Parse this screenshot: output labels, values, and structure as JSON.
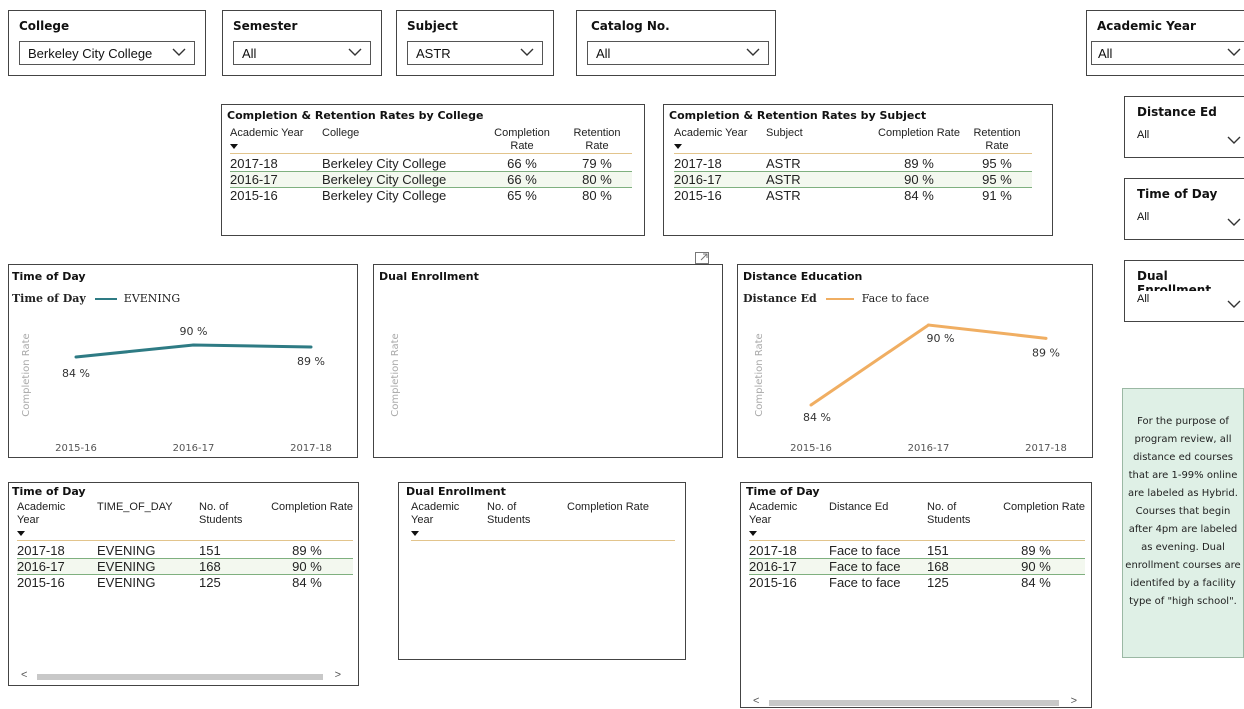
{
  "filters": {
    "college": {
      "label": "College",
      "value": "Berkeley City College"
    },
    "semester": {
      "label": "Semester",
      "value": "All"
    },
    "subject": {
      "label": "Subject",
      "value": "ASTR"
    },
    "catalog": {
      "label": "Catalog No.",
      "value": "All"
    },
    "academic_year": {
      "label": "Academic Year",
      "value": "All"
    },
    "distance_ed": {
      "label": "Distance Ed",
      "value": "All"
    },
    "time_of_day": {
      "label": "Time of Day",
      "value": "All"
    },
    "dual_enrollment": {
      "label": "Dual Enrollment",
      "value": "All"
    }
  },
  "table_college": {
    "title": "Completion & Retention Rates by College",
    "headers": [
      "Academic Year",
      "College",
      "Completion Rate",
      "Retention Rate"
    ],
    "rows": [
      [
        "2017-18",
        "Berkeley City College",
        "66 %",
        "79 %"
      ],
      [
        "2016-17",
        "Berkeley City College",
        "66 %",
        "80 %"
      ],
      [
        "2015-16",
        "Berkeley City College",
        "65 %",
        "80 %"
      ]
    ]
  },
  "table_subject": {
    "title": "Completion & Retention Rates by Subject",
    "headers": [
      "Academic Year",
      "Subject",
      "Completion Rate",
      "Retention Rate"
    ],
    "rows": [
      [
        "2017-18",
        "ASTR",
        "89 %",
        "95 %"
      ],
      [
        "2016-17",
        "ASTR",
        "90 %",
        "95 %"
      ],
      [
        "2015-16",
        "ASTR",
        "84 %",
        "91 %"
      ]
    ]
  },
  "chart_data": [
    {
      "type": "line",
      "title": "Time of Day",
      "legend_title": "Time of Day",
      "ylabel": "Completion Rate",
      "categories": [
        "2015-16",
        "2016-17",
        "2017-18"
      ],
      "series": [
        {
          "name": "EVENING",
          "values": [
            84,
            90,
            89
          ],
          "color": "#2e7b84"
        }
      ],
      "data_labels": [
        "84 %",
        "90 %",
        "89 %"
      ]
    },
    {
      "type": "line",
      "title": "Dual Enrollment",
      "ylabel": "Completion Rate",
      "categories": [],
      "series": []
    },
    {
      "type": "line",
      "title": "Distance Education",
      "legend_title": "Distance Ed",
      "ylabel": "Completion Rate",
      "categories": [
        "2015-16",
        "2016-17",
        "2017-18"
      ],
      "series": [
        {
          "name": "Face to face",
          "values": [
            84,
            90,
            89
          ],
          "color": "#f0ae62"
        }
      ],
      "data_labels": [
        "84 %",
        "90 %",
        "89 %"
      ]
    }
  ],
  "table_time": {
    "title": "Time of Day",
    "headers": [
      "Academic Year",
      "TIME_OF_DAY",
      "No. of Students",
      "Completion Rate"
    ],
    "rows": [
      [
        "2017-18",
        "EVENING",
        "151",
        "89 %"
      ],
      [
        "2016-17",
        "EVENING",
        "168",
        "90 %"
      ],
      [
        "2015-16",
        "EVENING",
        "125",
        "84 %"
      ]
    ]
  },
  "table_dual": {
    "title": "Dual Enrollment",
    "headers": [
      "Academic Year",
      "No. of Students",
      "Completion Rate"
    ]
  },
  "table_disted": {
    "title": "Time of Day",
    "headers": [
      "Academic Year",
      "Distance Ed",
      "No. of Students",
      "Completion Rate"
    ],
    "rows": [
      [
        "2017-18",
        "Face to face",
        "151",
        "89 %"
      ],
      [
        "2016-17",
        "Face to face",
        "168",
        "90 %"
      ],
      [
        "2015-16",
        "Face to face",
        "125",
        "84 %"
      ]
    ]
  },
  "note": "For the purpose of program review, all distance ed courses that are 1-99% online are labeled as Hybrid. Courses that begin after 4pm are labeled as evening. Dual enrollment courses are identifed by a facility type of \"high school\".",
  "scroll": {
    "left": "<",
    "right": ">"
  },
  "icons": {
    "expand": "expand-icon",
    "chevron": "chevron-down-icon",
    "sort": "sort-desc-icon"
  }
}
